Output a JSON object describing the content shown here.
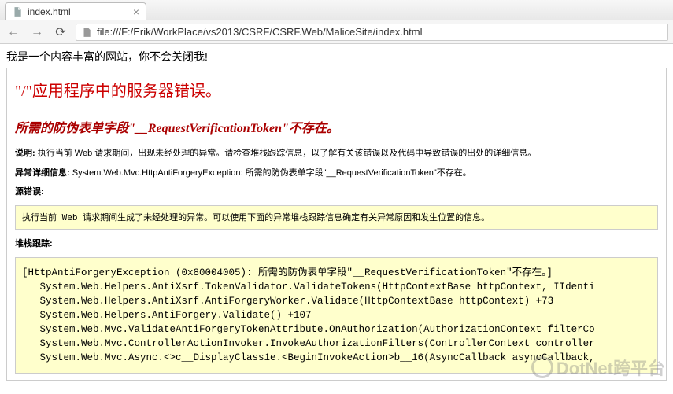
{
  "tab": {
    "title": "index.html",
    "close": "×"
  },
  "nav": {
    "back": "←",
    "forward": "→",
    "reload": "⟳"
  },
  "url": "file:///F:/Erik/WorkPlace/vs2013/CSRF/CSRF.Web/MaliceSite/index.html",
  "banner": "我是一个内容丰富的网站，你不会关闭我!",
  "error": {
    "title": "\"/\"应用程序中的服务器错误。",
    "subtitle": "所需的防伪表单字段\"__RequestVerificationToken\"不存在。",
    "desc_label": "说明:",
    "desc_text": " 执行当前 Web 请求期间，出现未经处理的异常。请检查堆栈跟踪信息，以了解有关该错误以及代码中导致错误的出处的详细信息。",
    "exc_label": "异常详细信息:",
    "exc_text": " System.Web.Mvc.HttpAntiForgeryException: 所需的防伪表单字段\"__RequestVerificationToken\"不存在。",
    "src_label": "源错误:",
    "src_msg": "执行当前 Web 请求期间生成了未经处理的异常。可以使用下面的异常堆栈跟踪信息确定有关异常原因和发生位置的信息。",
    "stack_label": "堆栈跟踪:",
    "stack": "[HttpAntiForgeryException (0x80004005): 所需的防伪表单字段\"__RequestVerificationToken\"不存在。]\n   System.Web.Helpers.AntiXsrf.TokenValidator.ValidateTokens(HttpContextBase httpContext, IIdenti\n   System.Web.Helpers.AntiXsrf.AntiForgeryWorker.Validate(HttpContextBase httpContext) +73\n   System.Web.Helpers.AntiForgery.Validate() +107\n   System.Web.Mvc.ValidateAntiForgeryTokenAttribute.OnAuthorization(AuthorizationContext filterCo\n   System.Web.Mvc.ControllerActionInvoker.InvokeAuthorizationFilters(ControllerContext controller\n   System.Web.Mvc.Async.<>c__DisplayClass1e.<BeginInvokeAction>b__16(AsyncCallback asyncCallback,"
  },
  "watermark": "DotNet跨平台"
}
